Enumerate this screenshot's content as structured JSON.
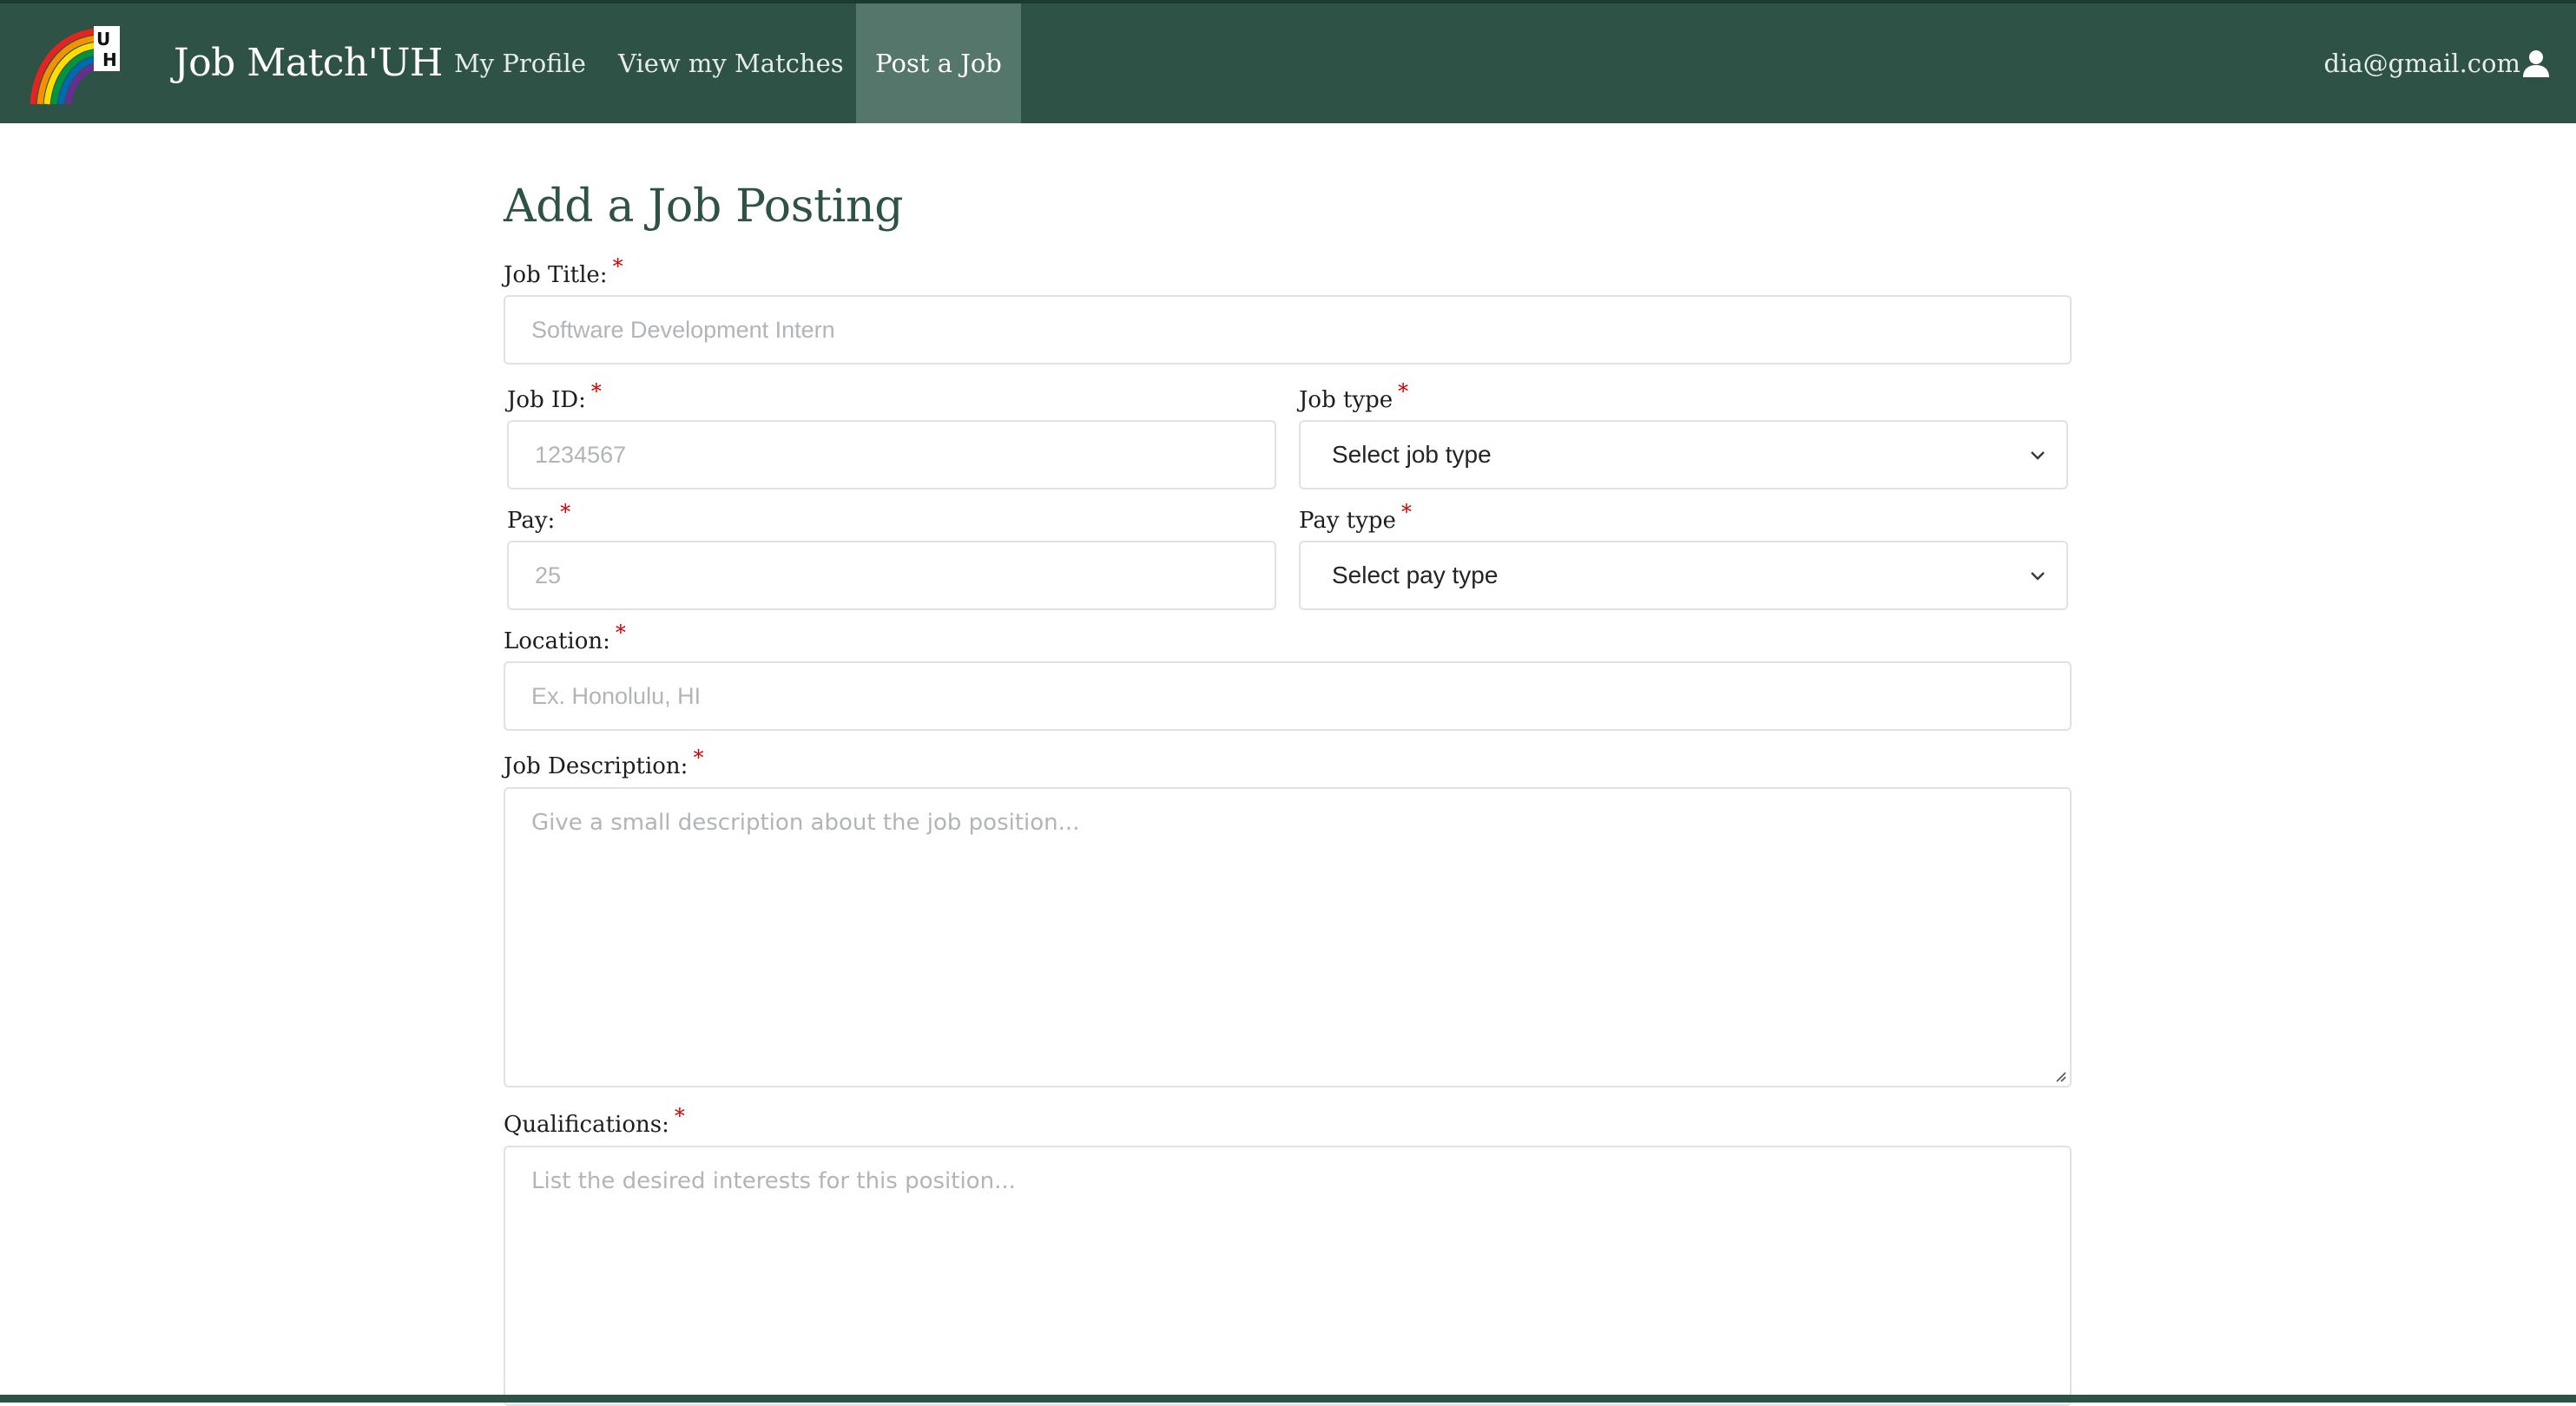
{
  "nav": {
    "brand": "Job Match'UH",
    "items": [
      {
        "label": "My Profile"
      },
      {
        "label": "View my Matches"
      },
      {
        "label": "Post a Job"
      }
    ],
    "user_email": "dia@gmail.com",
    "logo_icon": "rainbow-uh-logo",
    "user_icon": "user-icon",
    "colors": {
      "navbar": "#2e5346",
      "active_tab": "#55766b",
      "heading": "#2e5346",
      "required": "#d00000"
    }
  },
  "form": {
    "heading": "Add a Job Posting",
    "required_mark": "*",
    "job_title": {
      "label": "Job Title:",
      "placeholder": "Software Development Intern"
    },
    "job_id": {
      "label": "Job ID:",
      "placeholder": "1234567"
    },
    "job_type": {
      "label": "Job type",
      "selected": "Select job type"
    },
    "pay": {
      "label": "Pay:",
      "placeholder": "25"
    },
    "pay_type": {
      "label": "Pay type",
      "selected": "Select pay type"
    },
    "location": {
      "label": "Location:",
      "placeholder": "Ex. Honolulu, HI"
    },
    "description": {
      "label": "Job Description:",
      "placeholder": "Give a small description about the job position..."
    },
    "qualifications": {
      "label": "Qualifications:",
      "placeholder": "List the desired interests for this position..."
    }
  }
}
